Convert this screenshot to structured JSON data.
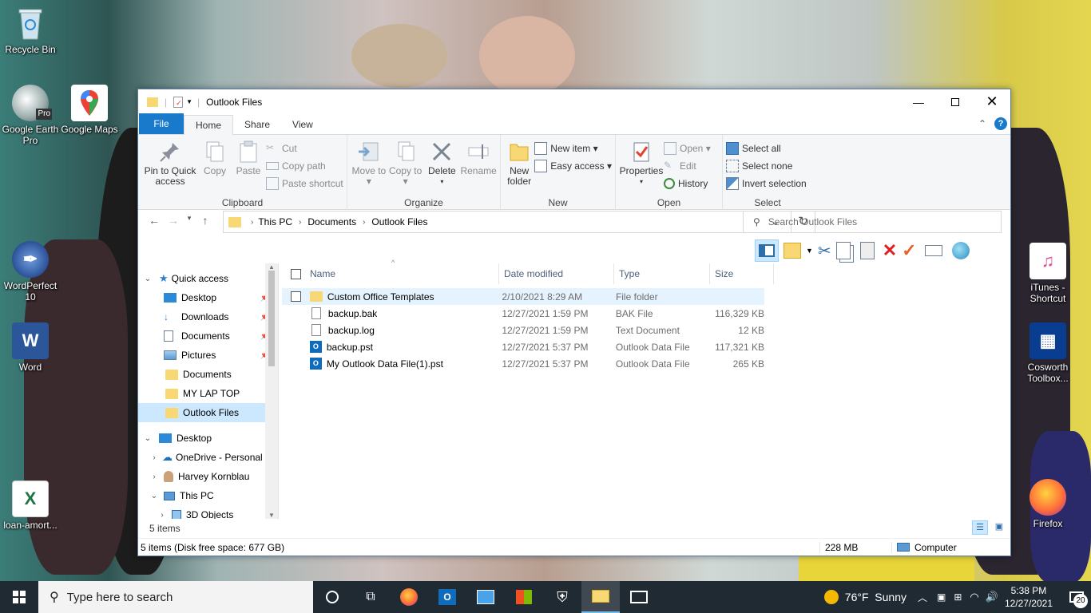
{
  "desktop": {
    "icons_left": [
      {
        "label": "Recycle Bin",
        "icon": "recycle-bin-icon"
      },
      {
        "label": "Google Earth Pro",
        "icon": "google-earth-icon"
      },
      {
        "label": "Google Maps",
        "icon": "google-maps-icon"
      },
      {
        "label": "WordPerfect 10",
        "icon": "wordperfect-icon"
      },
      {
        "label": "Word",
        "icon": "word-icon"
      },
      {
        "label": "loan-amort...",
        "icon": "excel-icon"
      }
    ],
    "icons_right": [
      {
        "label": "iTunes - Shortcut",
        "icon": "itunes-icon"
      },
      {
        "label": "Cosworth Toolbox...",
        "icon": "cosworth-icon"
      },
      {
        "label": "Firefox",
        "icon": "firefox-icon"
      }
    ],
    "earth_badge": "Pro"
  },
  "window": {
    "title": "Outlook Files",
    "tabs": [
      "File",
      "Home",
      "Share",
      "View"
    ],
    "active_tab": "Home",
    "ribbon": {
      "clipboard": {
        "label": "Clipboard",
        "pin": "Pin to Quick access",
        "copy": "Copy",
        "paste": "Paste",
        "cut": "Cut",
        "copy_path": "Copy path",
        "paste_shortcut": "Paste shortcut"
      },
      "organize": {
        "label": "Organize",
        "move_to": "Move to",
        "copy_to": "Copy to",
        "delete": "Delete",
        "rename": "Rename"
      },
      "new": {
        "label": "New",
        "new_folder": "New folder",
        "new_item": "New item",
        "easy_access": "Easy access"
      },
      "open": {
        "label": "Open",
        "properties": "Properties",
        "open": "Open",
        "edit": "Edit",
        "history": "History"
      },
      "select": {
        "label": "Select",
        "select_all": "Select all",
        "select_none": "Select none",
        "invert": "Invert selection"
      }
    },
    "breadcrumb": [
      "This PC",
      "Documents",
      "Outlook Files"
    ],
    "search_placeholder": "Search Outlook Files",
    "nav": {
      "quick_access": "Quick access",
      "quick_items": [
        {
          "label": "Desktop",
          "pinned": true
        },
        {
          "label": "Downloads",
          "pinned": true
        },
        {
          "label": "Documents",
          "pinned": true
        },
        {
          "label": "Pictures",
          "pinned": true
        },
        {
          "label": "Documents",
          "pinned": false
        },
        {
          "label": "MY LAP TOP",
          "pinned": false
        },
        {
          "label": "Outlook Files",
          "pinned": false
        }
      ],
      "tree": [
        "Desktop",
        "OneDrive - Personal",
        "Harvey Kornblau",
        "This PC",
        "3D Objects"
      ]
    },
    "columns": [
      "Name",
      "Date modified",
      "Type",
      "Size"
    ],
    "files": [
      {
        "name": "Custom Office Templates",
        "date": "2/10/2021 8:29 AM",
        "type": "File folder",
        "size": "",
        "kind": "folder"
      },
      {
        "name": "backup.bak",
        "date": "12/27/2021 1:59 PM",
        "type": "BAK File",
        "size": "116,329 KB",
        "kind": "file"
      },
      {
        "name": "backup.log",
        "date": "12/27/2021 1:59 PM",
        "type": "Text Document",
        "size": "12 KB",
        "kind": "file"
      },
      {
        "name": "backup.pst",
        "date": "12/27/2021 5:37 PM",
        "type": "Outlook Data File",
        "size": "117,321 KB",
        "kind": "pst"
      },
      {
        "name": "My Outlook Data File(1).pst",
        "date": "12/27/2021 5:37 PM",
        "type": "Outlook Data File",
        "size": "265 KB",
        "kind": "pst"
      }
    ],
    "item_count": "5 items",
    "status_left": "5 items (Disk free space: 677 GB)",
    "status_size": "228 MB",
    "status_location": "Computer"
  },
  "taskbar": {
    "search_placeholder": "Type here to search",
    "weather": "76°F  Sunny",
    "time": "5:38 PM",
    "date": "12/27/2021",
    "notifications": "20"
  }
}
